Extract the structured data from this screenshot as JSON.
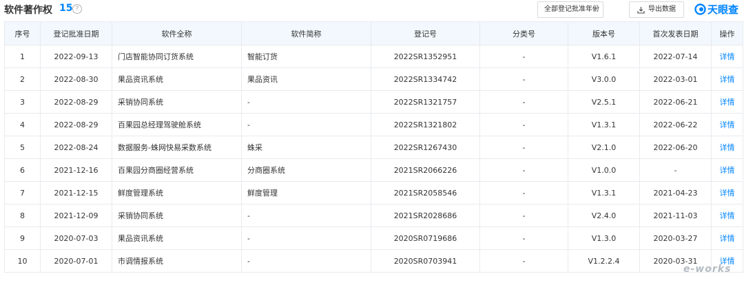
{
  "header": {
    "title": "软件著作权",
    "count": "15",
    "help_symbol": "?",
    "year_filter": "全部登记批准年份",
    "export_label": "导出数据",
    "brand": "天眼查"
  },
  "table": {
    "columns": [
      "序号",
      "登记批准日期",
      "软件全称",
      "软件简称",
      "登记号",
      "分类号",
      "版本号",
      "首次发表日期",
      "操作"
    ],
    "rows": [
      {
        "no": "1",
        "date": "2022-09-13",
        "name": "门店智能协同订货系统",
        "short": "智能订货",
        "reg": "2022SR1352951",
        "cls": "-",
        "ver": "V1.6.1",
        "pub": "2022-07-14",
        "op": "详情"
      },
      {
        "no": "2",
        "date": "2022-08-30",
        "name": "果品资讯系统",
        "short": "果品资讯",
        "reg": "2022SR1334742",
        "cls": "-",
        "ver": "V3.0.0",
        "pub": "2022-03-01",
        "op": "详情"
      },
      {
        "no": "3",
        "date": "2022-08-29",
        "name": "采销协同系统",
        "short": "-",
        "reg": "2022SR1321757",
        "cls": "-",
        "ver": "V2.5.1",
        "pub": "2022-06-21",
        "op": "详情"
      },
      {
        "no": "4",
        "date": "2022-08-29",
        "name": "百果园总经理驾驶舱系统",
        "short": "-",
        "reg": "2022SR1321802",
        "cls": "-",
        "ver": "V1.3.1",
        "pub": "2022-06-22",
        "op": "详情"
      },
      {
        "no": "5",
        "date": "2022-08-24",
        "name": "数据服务-蛛网快易采数系统",
        "short": "蛛采",
        "reg": "2022SR1267430",
        "cls": "-",
        "ver": "V2.1.0",
        "pub": "2022-06-20",
        "op": "详情"
      },
      {
        "no": "6",
        "date": "2021-12-16",
        "name": "百果园分商圈经营系统",
        "short": "分商圈系统",
        "reg": "2021SR2066226",
        "cls": "-",
        "ver": "V1.0.0",
        "pub": "-",
        "op": "详情"
      },
      {
        "no": "7",
        "date": "2021-12-15",
        "name": "鲜度管理系统",
        "short": "鲜度管理",
        "reg": "2021SR2058546",
        "cls": "-",
        "ver": "V1.3.1",
        "pub": "2021-04-23",
        "op": "详情"
      },
      {
        "no": "8",
        "date": "2021-12-09",
        "name": "采销协同系统",
        "short": "-",
        "reg": "2021SR2028686",
        "cls": "-",
        "ver": "V2.4.0",
        "pub": "2021-11-03",
        "op": "详情"
      },
      {
        "no": "9",
        "date": "2020-07-03",
        "name": "果品资讯系统",
        "short": "-",
        "reg": "2020SR0719686",
        "cls": "-",
        "ver": "V1.3.0",
        "pub": "2020-03-27",
        "op": "详情"
      },
      {
        "no": "10",
        "date": "2020-07-01",
        "name": "市调情报系统",
        "short": "-",
        "reg": "2020SR0703941",
        "cls": "-",
        "ver": "V1.2.2.4",
        "pub": "2020-03-31",
        "op": "详情"
      }
    ]
  },
  "watermark": "e-works",
  "colors": {
    "accent": "#0084ff",
    "header_bg": "#f2f8fd",
    "border": "#e8eaee"
  }
}
